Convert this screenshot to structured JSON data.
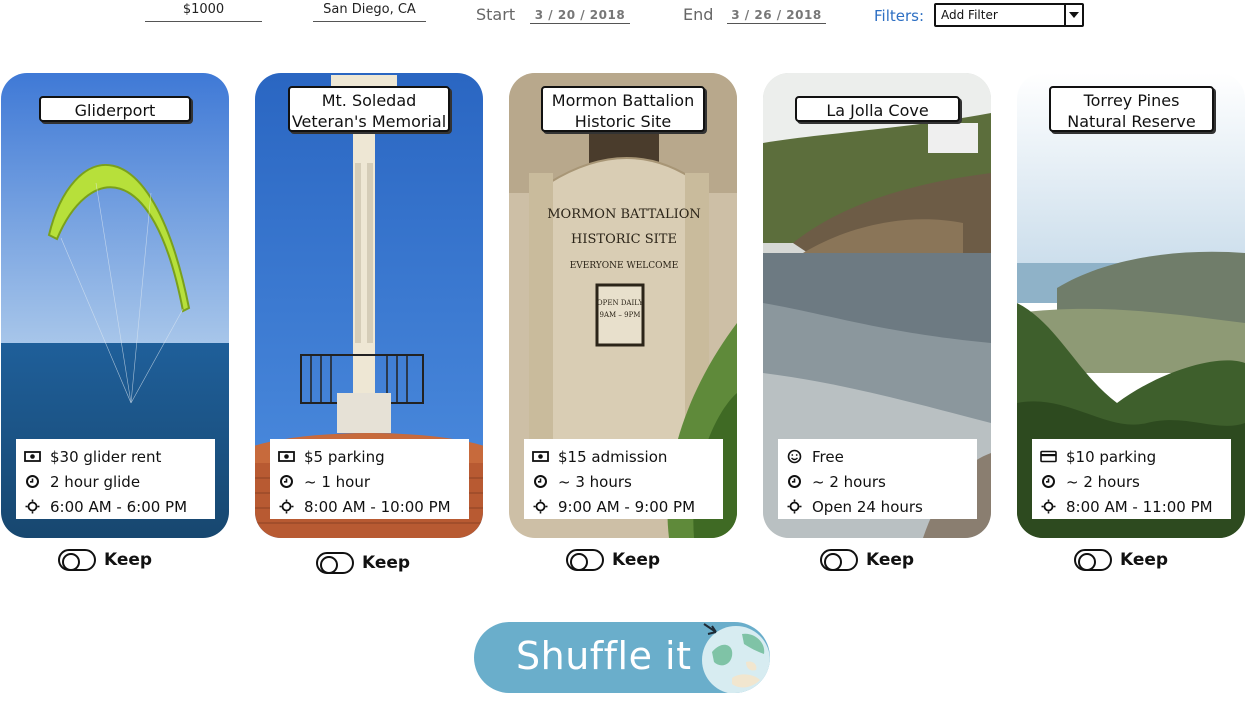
{
  "top_bar": {
    "budget": "$1000",
    "location": "San Diego, CA",
    "start_label": "Start",
    "start_date": "3 / 20 / 2018",
    "end_label": "End",
    "end_date": "3 / 26 / 2018",
    "filters_label": "Filters:",
    "filter_select_value": "Add Filter"
  },
  "cards": [
    {
      "title": [
        "Gliderport"
      ],
      "cost": "$30 glider rent",
      "duration": "2 hour glide",
      "hours": "6:00 AM - 6:00 PM",
      "cost_icon": "cash-icon",
      "keep_label": "Keep"
    },
    {
      "title": [
        "Mt. Soledad",
        "Veteran's Memorial"
      ],
      "cost": "$5 parking",
      "duration": "~ 1 hour",
      "hours": "8:00 AM - 10:00 PM",
      "cost_icon": "cash-icon",
      "keep_label": "Keep"
    },
    {
      "title": [
        "Mormon Battalion",
        "Historic Site"
      ],
      "cost": "$15 admission",
      "duration": "~ 3 hours",
      "hours": "9:00 AM - 9:00 PM",
      "cost_icon": "cash-icon",
      "keep_label": "Keep"
    },
    {
      "title": [
        "La Jolla Cove"
      ],
      "cost": "Free",
      "duration": "~ 2 hours",
      "hours": "Open 24 hours",
      "cost_icon": "smiley-icon",
      "keep_label": "Keep"
    },
    {
      "title": [
        "Torrey Pines",
        "Natural Reserve"
      ],
      "cost": "$10 parking",
      "duration": "~ 2 hours",
      "hours": "8:00 AM - 11:00 PM",
      "cost_icon": "credit-card-icon",
      "keep_label": "Keep"
    }
  ],
  "photo_sign": {
    "line1": "MORMON BATTALION",
    "line2": "HISTORIC SITE",
    "line3": "EVERYONE WELCOME",
    "line4": "OPEN DAILY",
    "line5": "9AM – 9PM"
  },
  "shuffle_button": {
    "label": "Shuffle it",
    "icon": "globe-icon"
  },
  "colors": {
    "accent": "#6aaecb",
    "filters_link": "#2d6fc3"
  }
}
